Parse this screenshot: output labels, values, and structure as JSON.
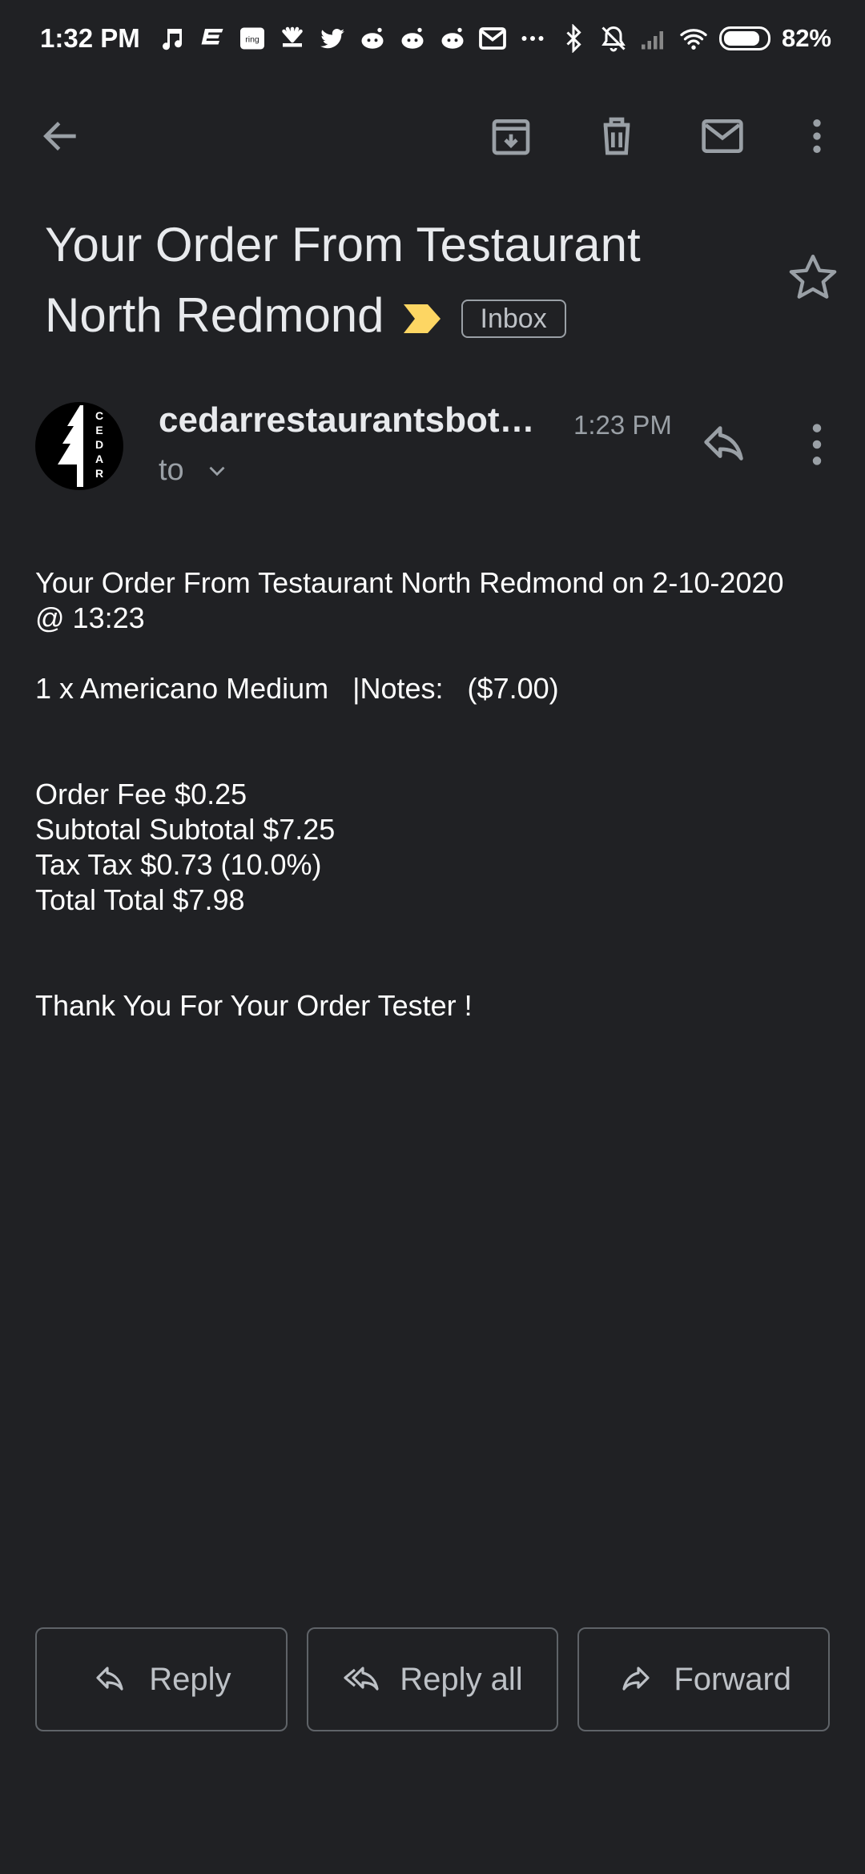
{
  "status_bar": {
    "time": "1:32 PM",
    "notification_icons": [
      "music-icon",
      "espn-icon",
      "ring-icon",
      "cnbc-icon",
      "twitter-icon",
      "reddit-icon",
      "reddit-icon",
      "reddit-icon",
      "gmail-icon",
      "more-icon"
    ],
    "ring_text": "ring",
    "battery_percent": "82%"
  },
  "toolbar": {
    "back_icon": "arrow-back-icon",
    "archive_icon": "archive-icon",
    "delete_icon": "trash-icon",
    "mark_unread_icon": "mail-icon",
    "overflow_icon": "more-vert-icon"
  },
  "email": {
    "subject_line1": "Your Order From Testaurant",
    "subject_line2": "North Redmond",
    "label": "Inbox",
    "sender": "cedarrestaurantsbot@...",
    "time": "1:23 PM",
    "recipient_label": "to",
    "avatar_text": "CEDAR",
    "body": {
      "line1": "Your Order From Testaurant North Redmond on 2-10-2020",
      "line2": "@ 13:23",
      "item": "1 x Americano Medium   |Notes:   ($7.00)",
      "order_fee": "Order Fee $0.25",
      "subtotal": "Subtotal Subtotal $7.25",
      "tax": "Tax Tax $0.73 (10.0%)",
      "total": "Total Total $7.98",
      "thanks": "Thank You For Your Order Tester !"
    }
  },
  "actions": {
    "reply": "Reply",
    "reply_all": "Reply all",
    "forward": "Forward"
  },
  "colors": {
    "background": "#202124",
    "important_marker": "#fdd663",
    "text_secondary": "#9aa0a6"
  }
}
